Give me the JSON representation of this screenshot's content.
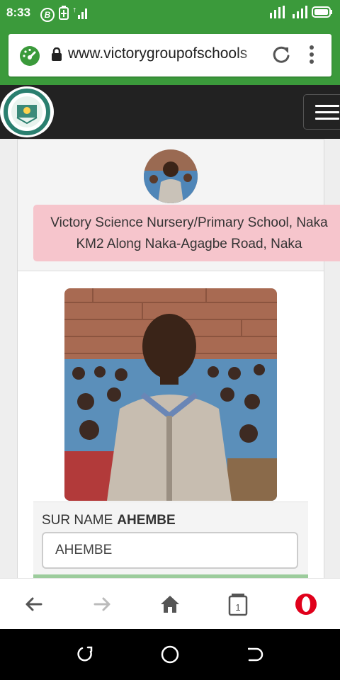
{
  "status_bar": {
    "time": "8:33",
    "left_icons": [
      "bitcoin-icon",
      "battery-saver-icon",
      "signal-icon"
    ],
    "right_icons": [
      "signal-4g-icon",
      "signal-icon",
      "battery-icon"
    ]
  },
  "browser": {
    "url": "www.victorygroupofschools",
    "icons": [
      "speed-dial-icon",
      "lock-icon",
      "reload-icon",
      "more-vert-icon"
    ]
  },
  "site_nav": {
    "logo_icon": "school-logo-icon",
    "menu_icon": "hamburger-icon"
  },
  "profile": {
    "school_line1": "Victory Science Nursery/Primary School, Naka",
    "school_line2": "KM2 Along Naka-Agagbe Road, Naka",
    "field_label": "SUR NAME",
    "field_label_value": "AHEMBE",
    "field_value": "AHEMBE"
  },
  "bottom_bar": {
    "tab_count": "1",
    "icons": [
      "back-icon",
      "forward-icon",
      "home-icon",
      "tabs-icon",
      "opera-icon"
    ]
  },
  "android_nav": {
    "icons": [
      "recents-icon",
      "home-circle-icon",
      "back-android-icon"
    ]
  },
  "colors": {
    "brand_green": "#3b9a3b",
    "nav_dark": "#222222",
    "banner_pink": "#f6c5cc",
    "opera_red": "#e0001b"
  }
}
